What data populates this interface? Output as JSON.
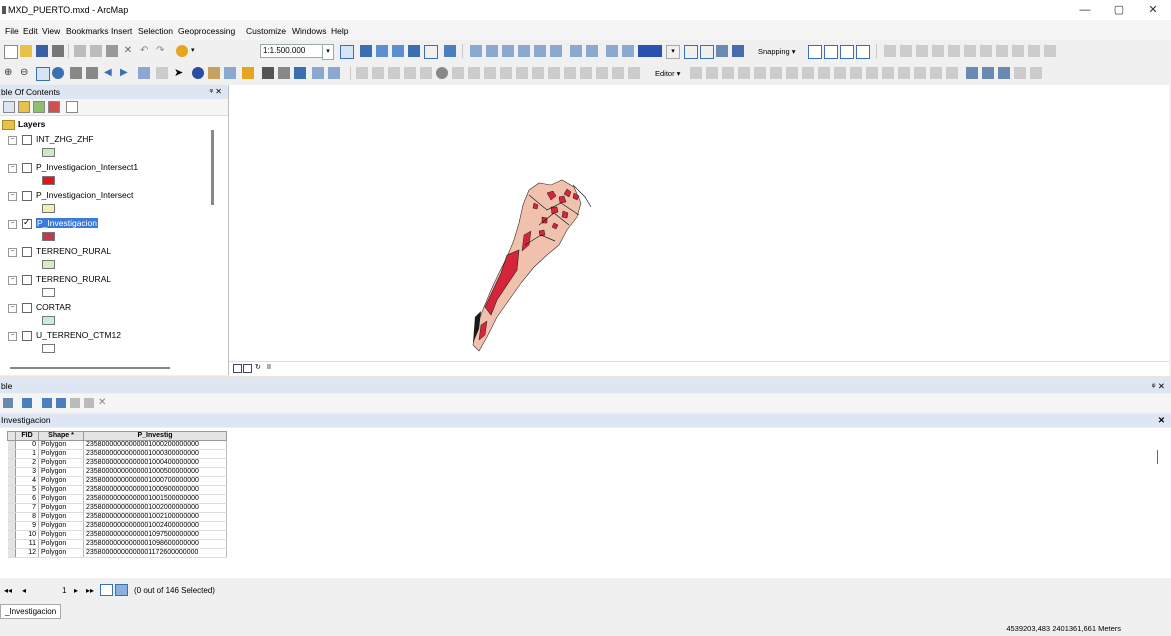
{
  "window": {
    "title": "MXD_PUERTO.mxd - ArcMap",
    "minimize": "—",
    "maximize": "▢",
    "close": "✕"
  },
  "menu": [
    "File",
    "Edit",
    "View",
    "Bookmarks",
    "Insert",
    "Selection",
    "Geoprocessing",
    "Customize",
    "Windows",
    "Help"
  ],
  "toolbar": {
    "scale": "1:1.500.000",
    "snapping_label": "Snapping ▾",
    "editor_label": "Editor ▾"
  },
  "toc": {
    "title": "ble Of Contents",
    "pin": "ᵠ ✕",
    "layers_label": "Layers",
    "layers": [
      {
        "name": "INT_ZHG_ZHF",
        "checked": false,
        "selected": false,
        "symbol_color": "#cfe8c4"
      },
      {
        "name": "P_Investigacion_Intersect1",
        "checked": false,
        "selected": false,
        "symbol_color": "#e2141c"
      },
      {
        "name": "P_Investigacion_Intersect",
        "checked": false,
        "selected": false,
        "symbol_color": "#f2f0b0"
      },
      {
        "name": "P_Investigacion",
        "checked": true,
        "selected": true,
        "symbol_color": "#c23a50"
      },
      {
        "name": "TERRENO_RURAL",
        "checked": false,
        "selected": false,
        "symbol_color": "#d7ecc0"
      },
      {
        "name": "TERRENO_RURAL",
        "checked": false,
        "selected": false,
        "symbol_color": "#ffffff"
      },
      {
        "name": "CORTAR",
        "checked": false,
        "selected": false,
        "symbol_color": "#c7ecd8"
      },
      {
        "name": "U_TERRENO_CTM12",
        "checked": false,
        "selected": false,
        "symbol_color": "#ffffff"
      }
    ]
  },
  "table_window": {
    "title": "ble",
    "pin": "ᵠ ✕",
    "tab_title": "Investigacion",
    "close": "✕",
    "columns": [
      "FID",
      "Shape *",
      "P_Investig"
    ],
    "rows": [
      [
        "0",
        "Polygon",
        "23580000000000001000200000000"
      ],
      [
        "1",
        "Polygon",
        "23580000000000001000300000000"
      ],
      [
        "2",
        "Polygon",
        "23580000000000001000400000000"
      ],
      [
        "3",
        "Polygon",
        "23580000000000001000500000000"
      ],
      [
        "4",
        "Polygon",
        "23580000000000001000700000000"
      ],
      [
        "5",
        "Polygon",
        "23580000000000001000900000000"
      ],
      [
        "6",
        "Polygon",
        "23580000000000001001500000000"
      ],
      [
        "7",
        "Polygon",
        "23580000000000001002000000000"
      ],
      [
        "8",
        "Polygon",
        "23580000000000001002100000000"
      ],
      [
        "9",
        "Polygon",
        "23580000000000001002400000000"
      ],
      [
        "10",
        "Polygon",
        "23580000000000001097500000000"
      ],
      [
        "11",
        "Polygon",
        "23580000000000001098600000000"
      ],
      [
        "12",
        "Polygon",
        "23580000000000001172600000000"
      ]
    ],
    "nav_first": "◂◂",
    "nav_prev": "◂",
    "current_record": "1",
    "nav_next": "▸",
    "nav_last": "▸▸",
    "selection_status": "(0 out of 146 Selected)",
    "bottom_tab": "_Investigacion"
  },
  "status": {
    "coordinates": "4539203,483  2401361,661 Meters"
  },
  "colors": {
    "map_fill": "#f0c2ae",
    "map_highlight": "#d6253a",
    "selection": "#3a7bd5"
  }
}
